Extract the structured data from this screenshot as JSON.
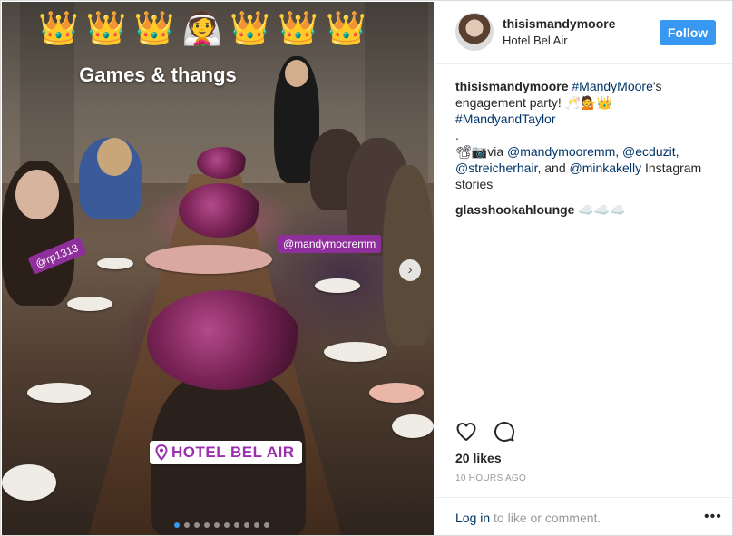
{
  "photo": {
    "stickers": "👑👑👑👰👑👑👑",
    "overlay_caption": "Games & thangs",
    "tags": [
      "@rp1313",
      "@mandymooremm"
    ],
    "location_sticker": "HOTEL BEL AIR",
    "carousel_total": 10,
    "carousel_active": 1
  },
  "header": {
    "username": "thisismandymoore",
    "location": "Hotel Bel Air",
    "follow_label": "Follow"
  },
  "caption": {
    "user": "thisismandymoore",
    "tag1": "#MandyMoore",
    "text1": "'s engagement party! 🥂💁👑",
    "tag2": "#MandyandTaylor",
    "dot": ".",
    "prefix": "📽📷via ",
    "mention1": "@mandymooremm",
    "sep1": ", ",
    "mention2": "@ecduzit",
    "sep2": ", ",
    "mention3": "@streicherhair",
    "sep3": ", and ",
    "mention4": "@minkakelly",
    "suffix": " Instagram stories"
  },
  "comment": {
    "user": "glasshookahlounge",
    "text": " ☁️☁️☁️"
  },
  "likes": "20 likes",
  "time": "10 HOURS AGO",
  "footer": {
    "login_link": "Log in",
    "login_rest": " to like or comment.",
    "more": "•••"
  },
  "colors": {
    "accent": "#3897f0",
    "link": "#003569",
    "tag_bg": "#8e2f9c",
    "location_text": "#9b2fae"
  }
}
